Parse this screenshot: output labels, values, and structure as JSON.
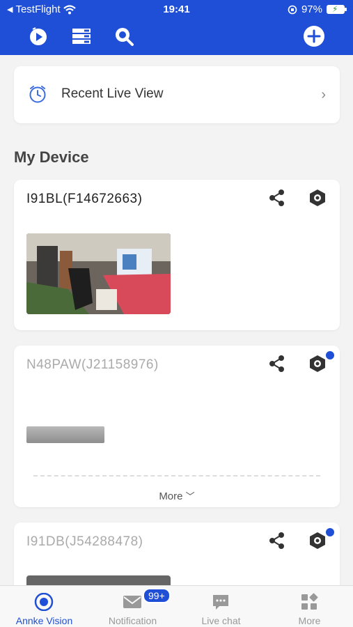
{
  "status_bar": {
    "back_app": "TestFlight",
    "time": "19:41",
    "battery": "97%"
  },
  "recent_live_view": {
    "label": "Recent Live View",
    "icon": "alarm-clock-icon"
  },
  "section_title": "My Device",
  "devices": [
    {
      "name": "I91BL(F14672663)",
      "dim": false,
      "badge_dot": false
    },
    {
      "name": "N48PAW(J21158976)",
      "dim": true,
      "badge_dot": true,
      "more_label": "More"
    },
    {
      "name": "I91DB(J54288478)",
      "dim": true,
      "badge_dot": true
    }
  ],
  "tabs": [
    {
      "label": "Annke Vision",
      "icon": "eye-icon",
      "active": true
    },
    {
      "label": "Notification",
      "icon": "mail-icon",
      "badge": "99+"
    },
    {
      "label": "Live chat",
      "icon": "chat-icon"
    },
    {
      "label": "More",
      "icon": "grid-icon"
    }
  ],
  "colors": {
    "brand_blue": "#1f4fd6",
    "background": "#f3f3f3"
  }
}
